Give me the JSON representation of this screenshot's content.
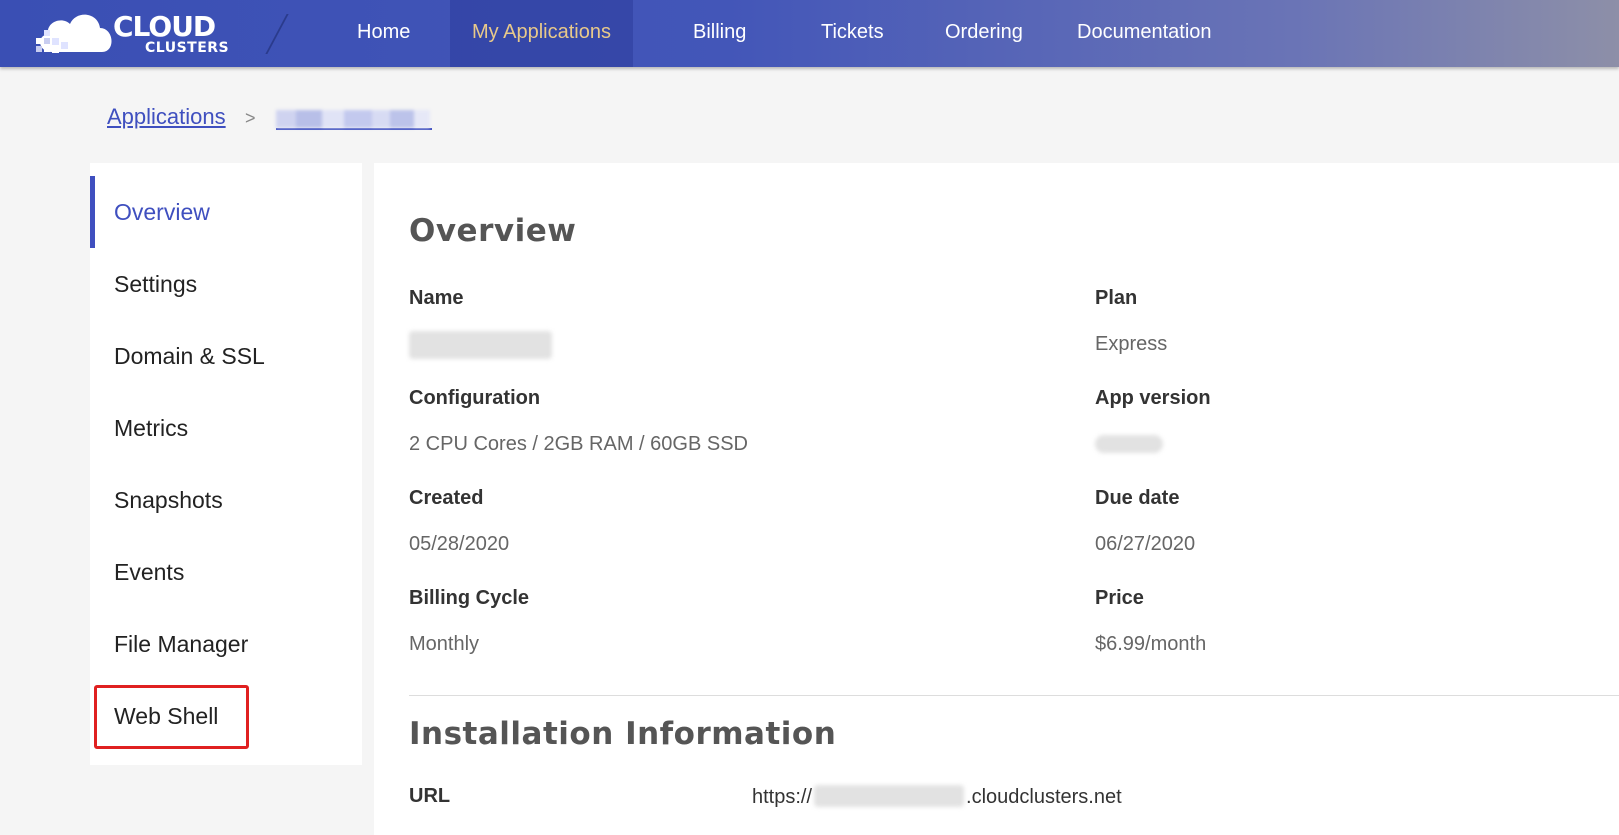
{
  "logo": {
    "line1": "CLOUD",
    "line2": "CLUSTERS"
  },
  "nav": [
    {
      "label": "Home",
      "active": false
    },
    {
      "label": "My Applications",
      "active": true
    },
    {
      "label": "Billing",
      "active": false
    },
    {
      "label": "Tickets",
      "active": false
    },
    {
      "label": "Ordering",
      "active": false
    },
    {
      "label": "Documentation",
      "active": false
    }
  ],
  "breadcrumb": {
    "root": "Applications",
    "separator": ">"
  },
  "sidebar": {
    "items": [
      {
        "label": "Overview",
        "active": true
      },
      {
        "label": "Settings"
      },
      {
        "label": "Domain & SSL"
      },
      {
        "label": "Metrics"
      },
      {
        "label": "Snapshots"
      },
      {
        "label": "Events"
      },
      {
        "label": "File Manager"
      },
      {
        "label": "Web Shell",
        "highlighted": true
      }
    ]
  },
  "overview": {
    "title": "Overview",
    "name_label": "Name",
    "plan_label": "Plan",
    "plan_value": "Express",
    "config_label": "Configuration",
    "config_value": "2 CPU Cores / 2GB RAM / 60GB SSD",
    "app_version_label": "App version",
    "created_label": "Created",
    "created_value": "05/28/2020",
    "due_label": "Due date",
    "due_value": "06/27/2020",
    "billing_label": "Billing Cycle",
    "billing_value": "Monthly",
    "price_label": "Price",
    "price_value": "$6.99/month"
  },
  "installation": {
    "title": "Installation Information",
    "url_label": "URL",
    "url_prefix": "https://",
    "url_suffix": ".cloudclusters.net"
  },
  "colors": {
    "accent": "#3f4fbf",
    "nav_active_text": "#e8c98a",
    "highlight_border": "#e02020"
  }
}
